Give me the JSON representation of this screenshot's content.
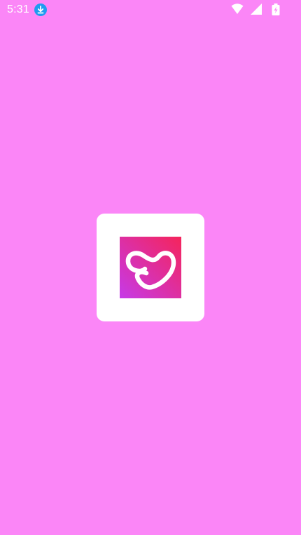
{
  "status_bar": {
    "time": "5:31",
    "icons": [
      "download-icon",
      "wifi-icon",
      "cell-signal-icon",
      "battery-charging-icon"
    ]
  },
  "splash": {
    "logo_icon": "heart-logo-icon"
  },
  "colors": {
    "background": "#FB86F7",
    "card": "#FFFFFF",
    "logo_gradient_start": "#C63AE8",
    "logo_gradient_end": "#F5245B",
    "download_badge": "#1E9BF0"
  }
}
